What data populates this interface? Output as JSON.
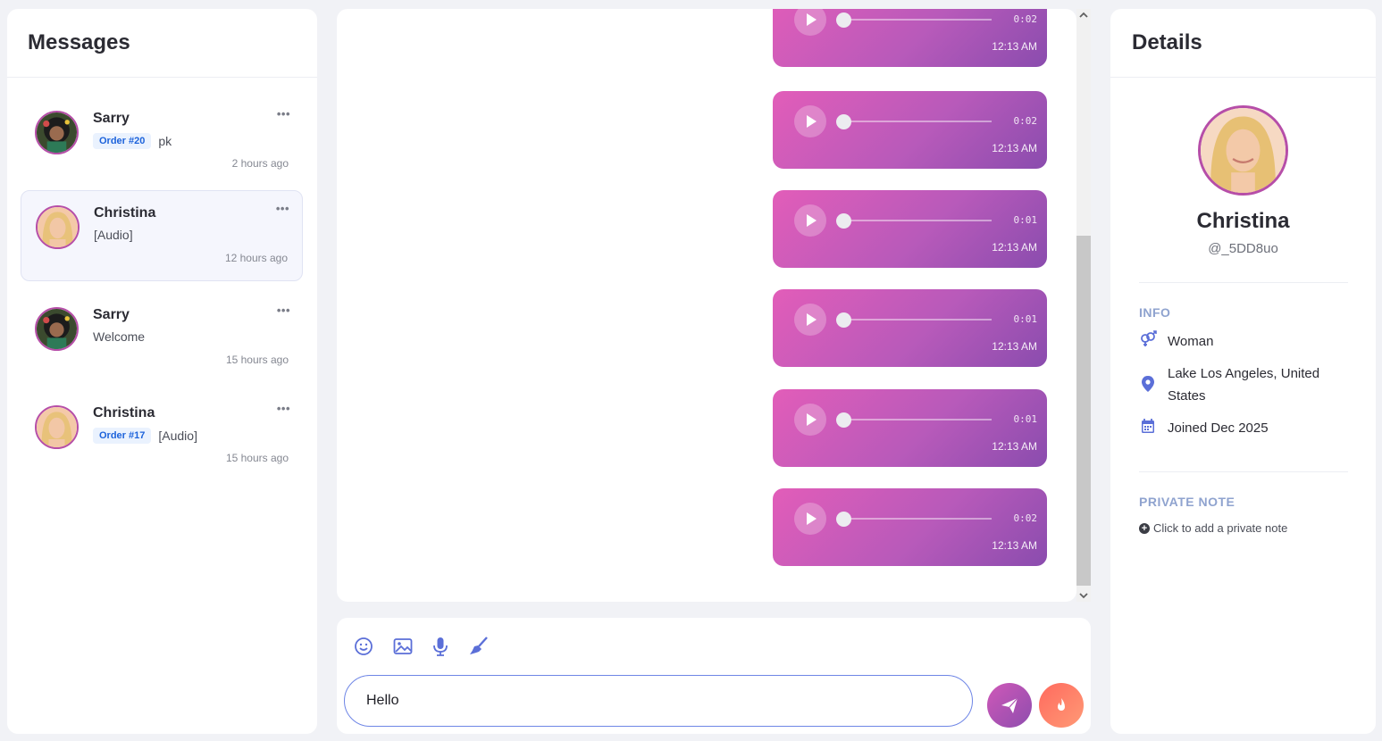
{
  "messages_panel": {
    "title": "Messages",
    "conversations": [
      {
        "name": "Sarry",
        "badge": "Order #20",
        "preview": "pk",
        "time": "2 hours ago",
        "more": "•••"
      },
      {
        "name": "Christina",
        "badge": "",
        "preview": "[Audio]",
        "time": "12 hours ago",
        "more": "•••"
      },
      {
        "name": "Sarry",
        "badge": "",
        "preview": "Welcome",
        "time": "15 hours ago",
        "more": "•••"
      },
      {
        "name": "Christina",
        "badge": "Order #17",
        "preview": "[Audio]",
        "time": "15 hours ago",
        "more": "•••"
      }
    ]
  },
  "chat": {
    "audio_messages": [
      {
        "duration": "0:02",
        "time": "12:13 AM",
        "progress": 0
      },
      {
        "duration": "0:02",
        "time": "12:13 AM",
        "progress": 0
      },
      {
        "duration": "0:01",
        "time": "12:13 AM",
        "progress": 0
      },
      {
        "duration": "0:01",
        "time": "12:13 AM",
        "progress": 0
      },
      {
        "duration": "0:01",
        "time": "12:13 AM",
        "progress": 0
      },
      {
        "duration": "0:02",
        "time": "12:13 AM",
        "progress": 0
      }
    ],
    "scroll_position": 0.62
  },
  "composer": {
    "tools": [
      "emoji-icon",
      "image-icon",
      "microphone-icon",
      "brush-icon"
    ],
    "input_value": "Hello",
    "send_icon": "paper-plane-icon",
    "gift_icon": "fire-icon"
  },
  "details_panel": {
    "title": "Details",
    "name": "Christina",
    "handle": "@_5DD8uo",
    "info_title": "INFO",
    "gender": "Woman",
    "location": "Lake Los Angeles, United States",
    "joined": "Joined Dec 2025",
    "private_note_title": "PRIVATE NOTE",
    "add_note_label": "Click to add a private note"
  },
  "colors": {
    "accent": "#6f86e6",
    "bubble_start": "#e25db9",
    "bubble_end": "#8a4cae",
    "avatar_ring": "#b64ea8",
    "badge_text": "#1d63db"
  }
}
